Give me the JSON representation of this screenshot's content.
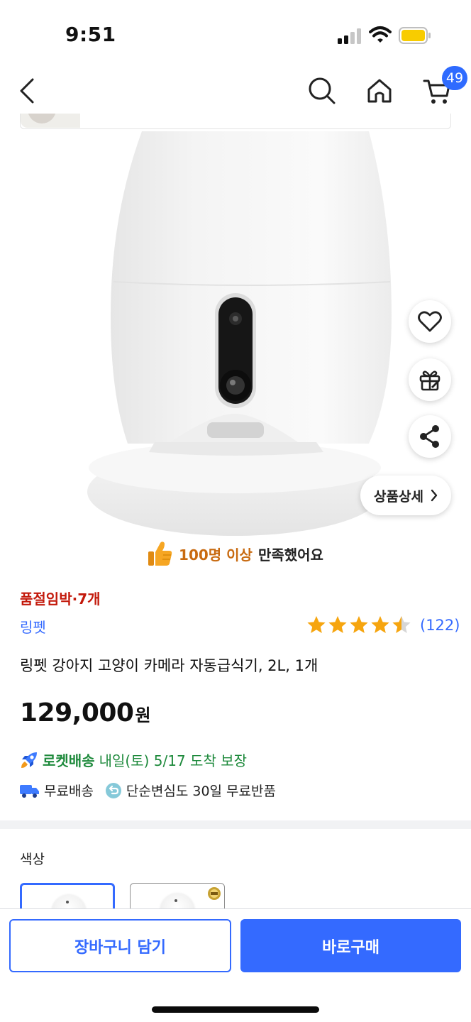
{
  "status_bar": {
    "time": "9:51"
  },
  "nav": {
    "cart_count": "49"
  },
  "product": {
    "satisfaction": {
      "count_text": "100명 이상",
      "rest_text": "만족했어요"
    },
    "stock_warning": "품절임박·7개",
    "brand": "링펫",
    "rating": {
      "stars": 4.5,
      "max_stars": 5,
      "review_count": "(122)"
    },
    "title": "링펫 강아지 고양이 카메라 자동급식기, 2L, 1개",
    "price": {
      "amount": "129,000",
      "currency": "원"
    },
    "delivery": {
      "rocket_label": "로켓배송",
      "arrival": "내일(토) 5/17 도착 보장",
      "free_shipping": "무료배송",
      "free_return": "단순변심도 30일 무료반품"
    },
    "detail_button": "상품상세"
  },
  "options": {
    "label": "색상"
  },
  "actions": {
    "add_to_cart": "장바구니 담기",
    "buy_now": "바로구매"
  },
  "colors": {
    "accent": "#346aff",
    "rocket_green": "#1e8a3c",
    "warning_red": "#c3190b",
    "star": "#f6a50f",
    "satisfaction_orange": "#c86a10"
  }
}
